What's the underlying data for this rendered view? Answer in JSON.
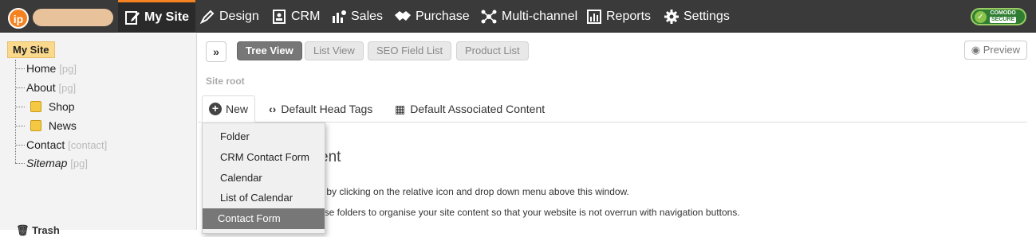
{
  "topnav": {
    "logo_text": "ip",
    "items": [
      {
        "label": "My Site",
        "icon": "edit-icon"
      },
      {
        "label": "Design",
        "icon": "brush-icon"
      },
      {
        "label": "CRM",
        "icon": "contacts-icon"
      },
      {
        "label": "Sales",
        "icon": "sales-icon"
      },
      {
        "label": "Purchase",
        "icon": "handshake-icon"
      },
      {
        "label": "Multi-channel",
        "icon": "network-icon"
      },
      {
        "label": "Reports",
        "icon": "chart-icon"
      },
      {
        "label": "Settings",
        "icon": "gear-icon"
      }
    ],
    "badge": {
      "line1": "COMODO",
      "line2": "SECURE"
    }
  },
  "sidebar": {
    "root": "My Site",
    "items": [
      {
        "label": "Home",
        "tag": "[pg]"
      },
      {
        "label": "About",
        "tag": "[pg]"
      },
      {
        "label": "Shop",
        "tag": ""
      },
      {
        "label": "News",
        "tag": ""
      },
      {
        "label": "Contact",
        "tag": "[contact]"
      },
      {
        "label": "Sitemap",
        "tag": "[pg]"
      }
    ],
    "trash": "Trash"
  },
  "toolbar": {
    "views": [
      "Tree View",
      "List View",
      "SEO Field List",
      "Product List"
    ],
    "preview": "Preview"
  },
  "breadcrumb": "Site root",
  "tabs": {
    "new": "New",
    "head_tags": "Default Head Tags",
    "assoc": "Default Associated Content"
  },
  "dropdown": {
    "items": [
      "Folder",
      "CRM Contact Form",
      "Calendar",
      "List of Calendar Events",
      "Contact Form"
    ]
  },
  "content": {
    "title": "ent",
    "line1": "s by clicking on the relative icon and drop down menu above this window.",
    "line2": "use folders to organise your site content so that your website is not overrun with navigation buttons."
  },
  "colors": {
    "accent": "#f58220",
    "nav_bg": "#3a3a3a",
    "highlight": "#fad98c"
  }
}
